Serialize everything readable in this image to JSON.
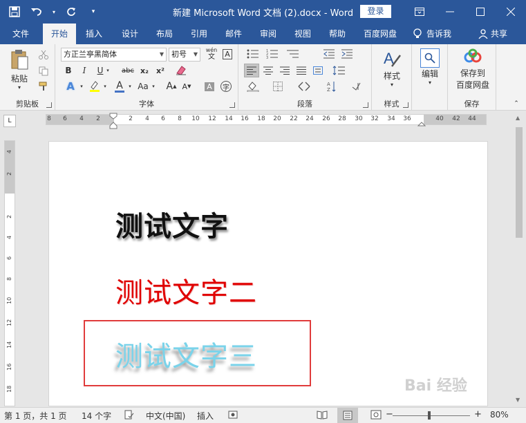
{
  "titlebar": {
    "title": "新建 Microsoft Word 文档 (2).docx  -  Word",
    "login": "登录"
  },
  "tabs": [
    "文件",
    "开始",
    "插入",
    "设计",
    "布局",
    "引用",
    "邮件",
    "审阅",
    "视图",
    "帮助",
    "百度网盘"
  ],
  "active_tab": "开始",
  "tellme": "告诉我",
  "share": "共享",
  "ribbon": {
    "clipboard": {
      "paste": "粘贴",
      "label": "剪贴板"
    },
    "font": {
      "font_name": "方正兰亭黑简体",
      "font_size": "初号",
      "phonetic": "wén",
      "label": "字体",
      "buttons": [
        "B",
        "I",
        "U",
        "abc",
        "x₂",
        "x²",
        "A",
        "Aa",
        "A",
        "A",
        "A"
      ]
    },
    "paragraph": {
      "label": "段落"
    },
    "styles": {
      "button": "样式",
      "label": "样式"
    },
    "editing": {
      "button": "编辑"
    },
    "save": {
      "button_line1": "保存到",
      "button_line2": "百度网盘",
      "label": "保存"
    }
  },
  "ruler": {
    "corner": "L",
    "h_numbers": [
      "8",
      "6",
      "4",
      "2",
      "2",
      "4",
      "6",
      "8",
      "10",
      "12",
      "14",
      "16",
      "18",
      "20",
      "22",
      "24",
      "26",
      "28",
      "30",
      "32",
      "34",
      "36",
      "40",
      "42",
      "44"
    ],
    "v_numbers": [
      "4",
      "2",
      "2",
      "4",
      "6",
      "8",
      "10",
      "12",
      "14",
      "16",
      "18"
    ]
  },
  "document": {
    "line1": "测试文字",
    "line2": "测试文字二",
    "line3": "测试文字三"
  },
  "colors": {
    "accent": "#2b579a",
    "line1": "#111111",
    "line2": "#e00000",
    "line3": "#7ad3ea",
    "highlight_box": "#e03b3b"
  },
  "statusbar": {
    "page": "第 1 页，共 1 页",
    "words": "14 个字",
    "language": "中文(中国)",
    "mode": "插入",
    "zoom": "80%"
  },
  "watermark": "Bai 经验"
}
